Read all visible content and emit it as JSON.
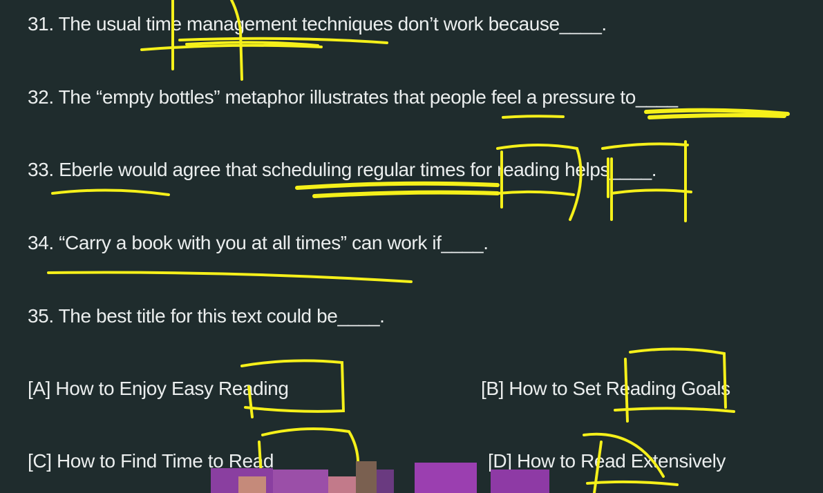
{
  "questions": [
    {
      "text": "31. The usual time management techniques don’t work because____."
    },
    {
      "text": "32. The “empty bottles” metaphor illustrates that people feel a pressure to____"
    },
    {
      "text": "33. Eberle would agree that scheduling regular times for reading helps____."
    },
    {
      "text": "34. “Carry a book with you at all times” can work if____."
    },
    {
      "text": "35. The best title for this text could be____."
    }
  ],
  "options": {
    "a": "[A] How to Enjoy Easy Reading",
    "b": "[B] How to Set Reading Goals",
    "c": "[C] How to Find Time to Read",
    "d": "[D] How to Read Extensively"
  },
  "colors": {
    "background": "#1f2c2d",
    "text": "#ebeeee",
    "annotation": "#f5f01a",
    "pixelation": "#9b3fb0"
  }
}
